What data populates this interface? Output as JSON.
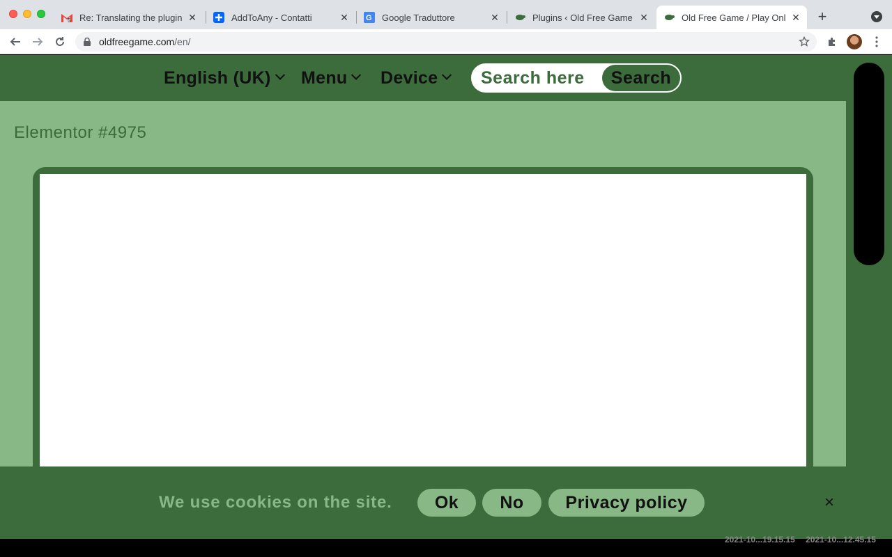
{
  "browser": {
    "tabs": [
      {
        "title": "Re: Translating the plugins",
        "icon": "gmail-icon",
        "badge": "5",
        "active": false
      },
      {
        "title": "AddToAny - Contatti",
        "icon": "addtoany-icon",
        "active": false
      },
      {
        "title": "Google Traduttore",
        "icon": "google-translate-icon",
        "active": false
      },
      {
        "title": "Plugins ‹ Old Free Game — ",
        "icon": "turtle-icon",
        "active": false
      },
      {
        "title": "Old Free Game / Play Onlin",
        "icon": "turtle-icon",
        "active": true
      }
    ],
    "url_host": "oldfreegame.com",
    "url_path": "/en/"
  },
  "header": {
    "language_label": "English (UK)",
    "menu_label": "Menu",
    "device_label": "Device",
    "search_placeholder": "Search here",
    "search_button": "Search"
  },
  "content": {
    "post_title": "Elementor #4975"
  },
  "cookie_bar": {
    "message": "We use cookies on the site.",
    "ok_label": "Ok",
    "no_label": "No",
    "privacy_label": "Privacy policy",
    "close_symbol": "×"
  },
  "desktop": {
    "labels": [
      "2021-10...19.15.15",
      "2021-10...12.45.15"
    ]
  },
  "colors": {
    "site_dark_green": "#3c6b3c",
    "site_light_green": "#87b885"
  }
}
